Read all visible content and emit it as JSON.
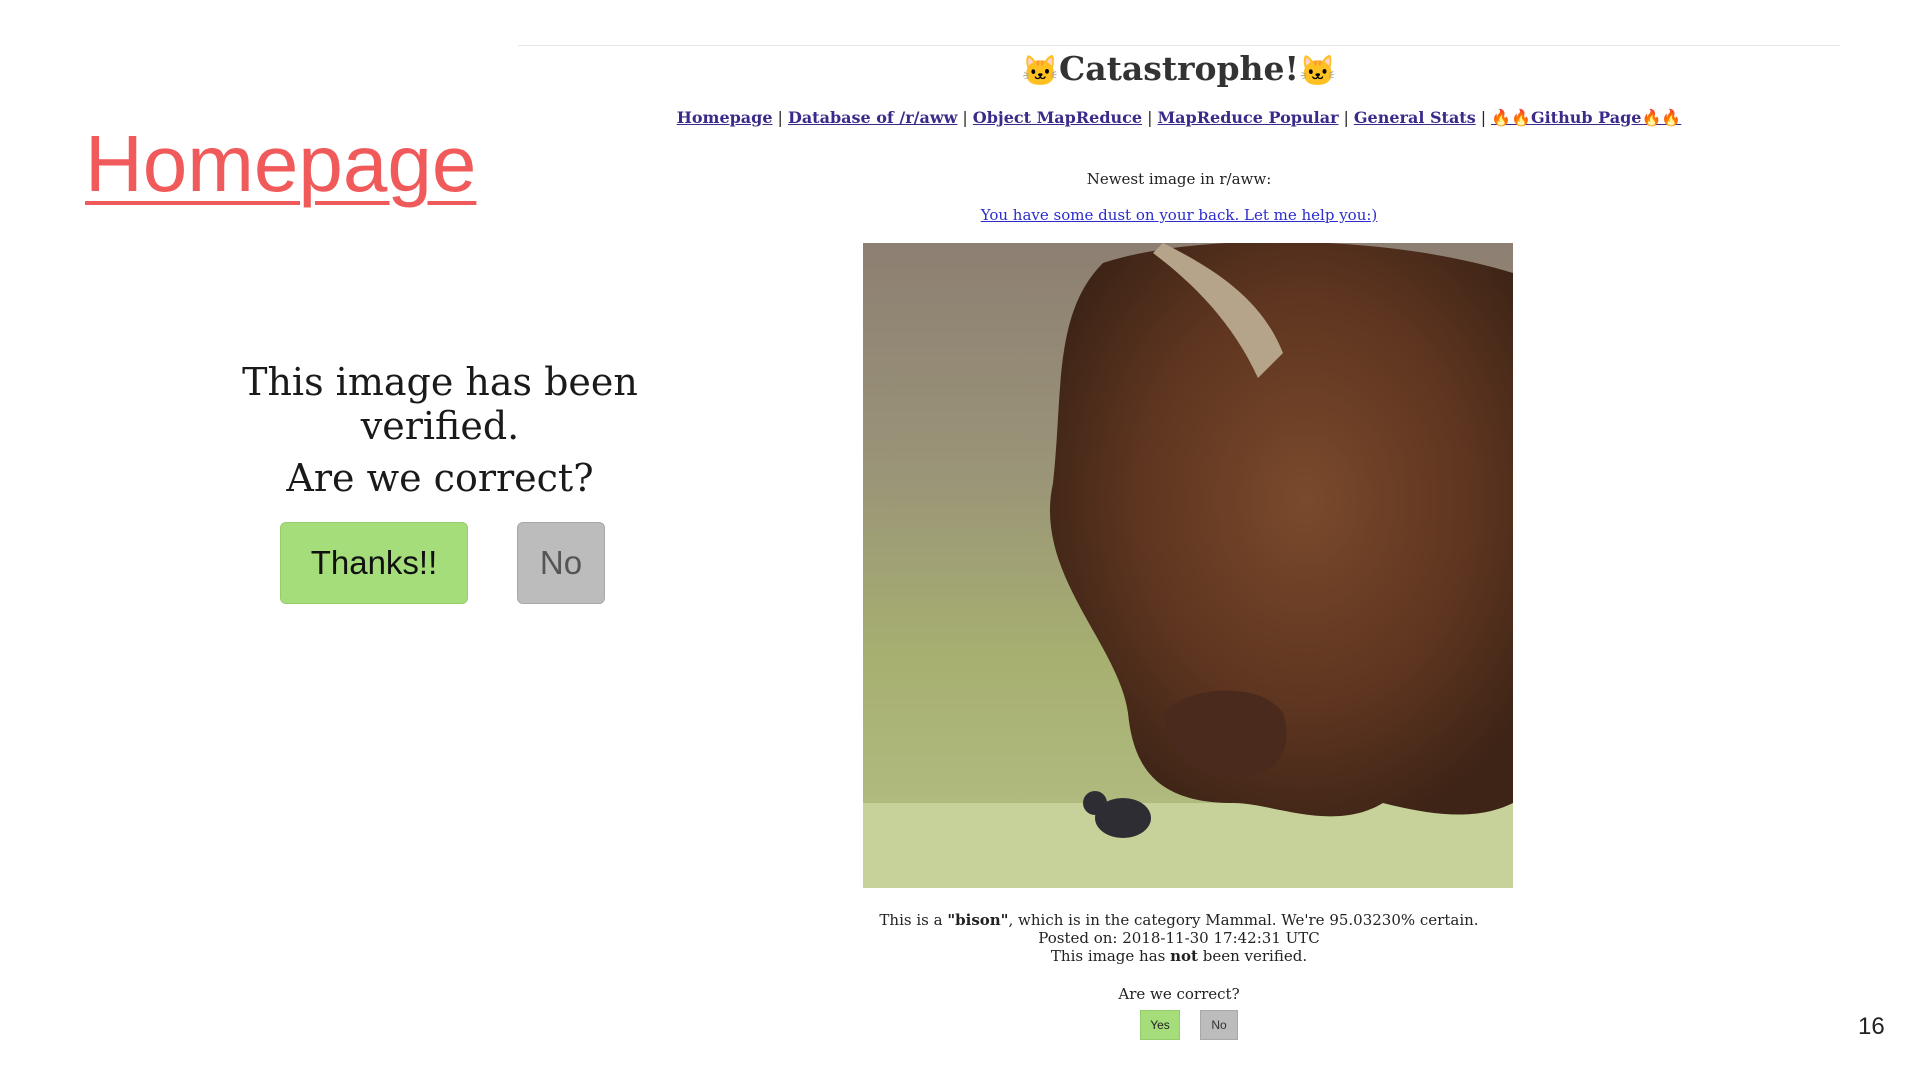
{
  "slide": {
    "title": "Homepage",
    "page_number": "16"
  },
  "zoom": {
    "verified_text": "This image has been verified.",
    "question": "Are we correct?",
    "thanks_label": "Thanks!!",
    "no_label": "No"
  },
  "site": {
    "title": "Catastrophe!",
    "title_emoji": "🐱",
    "nav": [
      {
        "label": "Homepage"
      },
      {
        "label": "Database of /r/aww"
      },
      {
        "label": "Object MapReduce"
      },
      {
        "label": "MapReduce Popular"
      },
      {
        "label": "General Stats"
      },
      {
        "label": "Github Page",
        "emoji": "🔥🔥"
      }
    ],
    "newest_label": "Newest image in r/aww:",
    "post_title": "You have some dust on your back. Let me help you:)",
    "caption": {
      "prefix": "This is a ",
      "label": "\"bison\"",
      "suffix": ", which is in the category Mammal. We're 95.03230% certain.",
      "posted": "Posted on: 2018-11-30 17:42:31 UTC",
      "verified_prefix": "This image has ",
      "verified_bold": "not",
      "verified_suffix": " been verified."
    },
    "question": "Are we correct?",
    "yes_label": "Yes",
    "no_label": "No"
  },
  "colors": {
    "title_accent": "#f05a5a",
    "yes_green": "#a6dd7b",
    "no_gray": "#bcbcbc",
    "link_purple": "#3b2a8a",
    "link_blue": "#2c2ccc"
  }
}
